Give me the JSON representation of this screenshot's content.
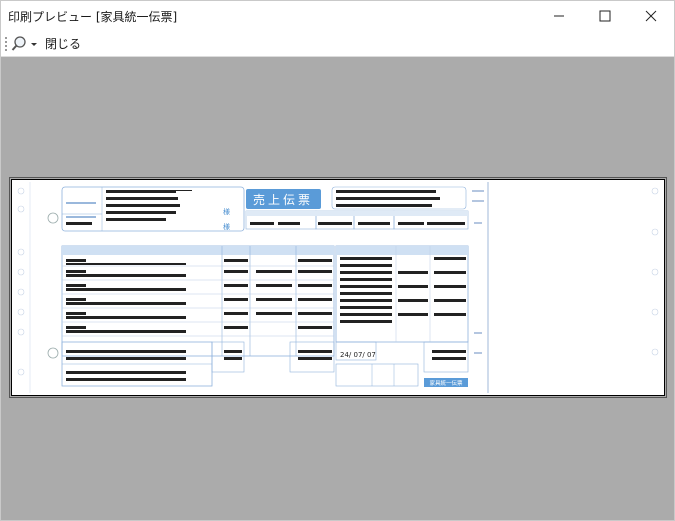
{
  "window": {
    "title": "印刷プレビュー [家具統一伝票]"
  },
  "toolbar": {
    "close_label": "閉じる"
  },
  "slip": {
    "badge_title": "売上伝票",
    "footer_label": "家具統一伝票",
    "sama_1": "様",
    "sama_2": "様",
    "date": "24/ 07/ 07"
  },
  "colors": {
    "accent": "#4a8fd0",
    "badge": "#5a9bd8",
    "viewport": "#ababab"
  }
}
